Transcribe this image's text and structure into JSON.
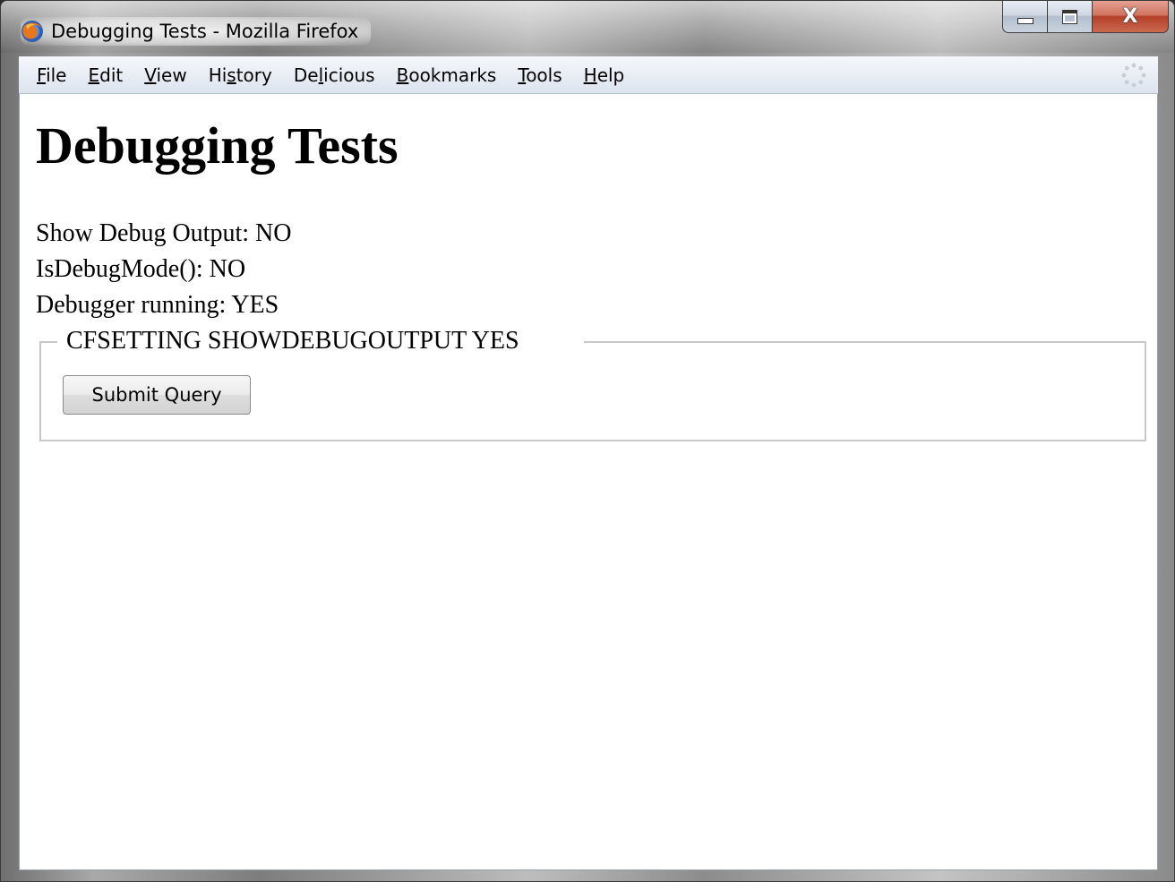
{
  "window": {
    "title": "Debugging Tests - Mozilla Firefox",
    "app_icon": "firefox-icon",
    "buttons": {
      "minimize_icon": "minimize-icon",
      "maximize_icon": "maximize-icon",
      "close_label": "X"
    }
  },
  "menubar": {
    "items": [
      {
        "accel": "F",
        "rest": "ile"
      },
      {
        "accel": "E",
        "rest": "dit"
      },
      {
        "accel": "V",
        "rest": "iew"
      },
      {
        "pre": "Hi",
        "accel": "s",
        "rest": "tory"
      },
      {
        "pre": "De",
        "accel": "l",
        "rest": "icious"
      },
      {
        "accel": "B",
        "rest": "ookmarks"
      },
      {
        "accel": "T",
        "rest": "ools"
      },
      {
        "accel": "H",
        "rest": "elp"
      }
    ],
    "throbber_icon": "throbber-icon"
  },
  "page": {
    "heading": "Debugging Tests",
    "lines": [
      "Show Debug Output: NO",
      "IsDebugMode(): NO",
      "Debugger running: YES"
    ],
    "fieldset": {
      "legend": "CFSETTING SHOWDEBUGOUTPUT YES",
      "submit_label": "Submit Query"
    }
  },
  "colors": {
    "close_button": "#c4553c",
    "page_background": "#ffffff",
    "text": "#000000"
  }
}
